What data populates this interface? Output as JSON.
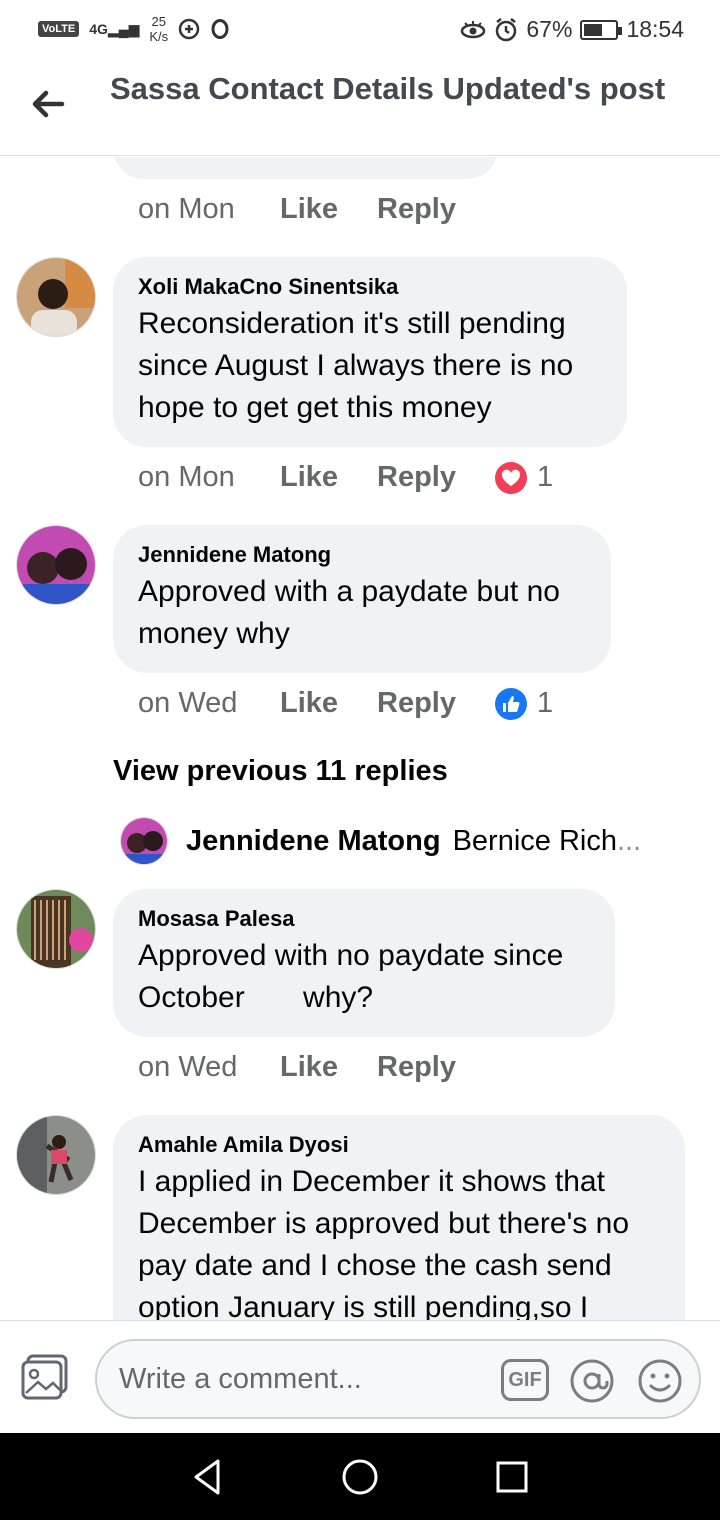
{
  "status_bar": {
    "volte": "VoLTE",
    "network": "4G",
    "speed_value": "25",
    "speed_unit": "K/s",
    "battery_percent": "67%",
    "battery_level": 0.67,
    "time": "18:54"
  },
  "header": {
    "title": "Sassa Contact Details Updated's post"
  },
  "comments": [
    {
      "author": "",
      "text": "",
      "time": "on Mon",
      "like": "Like",
      "reply": "Reply",
      "reaction_count": ""
    },
    {
      "author": "Xoli MakaCno Sinentsika",
      "text": "Reconsideration it's still pending since August I always there is no hope to get get this money",
      "time": "on Mon",
      "like": "Like",
      "reply": "Reply",
      "reaction": "heart-icon",
      "reaction_count": "1"
    },
    {
      "author": "Jennidene Matong",
      "text": "Approved with a paydate but no money why",
      "time": "on Wed",
      "like": "Like",
      "reply": "Reply",
      "reaction": "thumbs-up-icon",
      "reaction_count": "1"
    },
    {
      "author": "Mosasa Palesa",
      "text": "Approved with no paydate since October       why?",
      "time": "on Wed",
      "like": "Like",
      "reply": "Reply"
    },
    {
      "author": "Amahle Amila Dyosi",
      "text": "I applied in December it shows that December is approved but there's no pay date and I chose the cash send option January is still pending,so I"
    }
  ],
  "view_previous": "View previous 11 replies",
  "reply_preview": {
    "name": "Jennidene Matong",
    "text": "Bernice Rich",
    "ellipsis": "..."
  },
  "composer": {
    "placeholder": "Write a comment...",
    "gif_label": "GIF"
  },
  "colors": {
    "bubble": "#f0f2f5",
    "heart": "#f33e58",
    "like_blue": "#1877f2",
    "secondary_text": "#65676b"
  }
}
